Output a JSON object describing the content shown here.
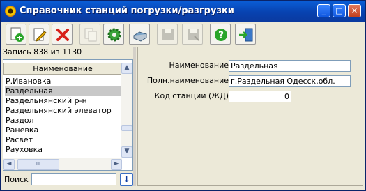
{
  "window": {
    "title": "Справочник станций погрузки/разгрузки",
    "controls": {
      "minimize": "_",
      "maximize": "□",
      "close": "✕"
    }
  },
  "toolbar": {
    "buttons": [
      {
        "name": "add",
        "icon": "add-document-icon",
        "enabled": true
      },
      {
        "name": "edit",
        "icon": "edit-pencil-icon",
        "enabled": true
      },
      {
        "name": "delete",
        "icon": "red-x-icon",
        "enabled": true
      },
      {
        "name": "copy",
        "icon": "copy-icon",
        "enabled": false
      },
      {
        "name": "settings",
        "icon": "green-gear-icon",
        "enabled": true
      },
      {
        "name": "print",
        "icon": "printer-icon",
        "enabled": true
      },
      {
        "name": "save",
        "icon": "floppy-icon",
        "enabled": false
      },
      {
        "name": "save-as",
        "icon": "floppy-multi-icon",
        "enabled": false
      },
      {
        "name": "help",
        "icon": "help-icon",
        "enabled": true
      },
      {
        "name": "exit",
        "icon": "exit-door-icon",
        "enabled": true
      }
    ],
    "colors": {
      "add": "#2aa52a",
      "delete": "#d8201a",
      "help": "#2aa52a",
      "gear": "#3aa23a"
    }
  },
  "status": {
    "record_text": "Запись 838 из 1130"
  },
  "list": {
    "column_header": "Наименование",
    "items": [
      "Р.Ивановка",
      "Раздельная",
      "Раздельнянский р-н",
      "Раздельнянский элеватор",
      "Раздол",
      "Раневка",
      "Расвет",
      "Рауховка"
    ],
    "selected_index": 1,
    "scroll": {
      "up": "▲",
      "down": "▼",
      "left": "◄",
      "right": "►",
      "grip": "III"
    }
  },
  "search": {
    "label": "Поиск",
    "value": "",
    "button_glyph": "↓"
  },
  "form": {
    "name_label": "Наименование",
    "name_value": "Раздельная",
    "fullname_label": "Полн.наименование",
    "fullname_value": "г.Раздельная Одесск.обл.",
    "code_label": "Код станции (ЖД)",
    "code_value": "0"
  }
}
